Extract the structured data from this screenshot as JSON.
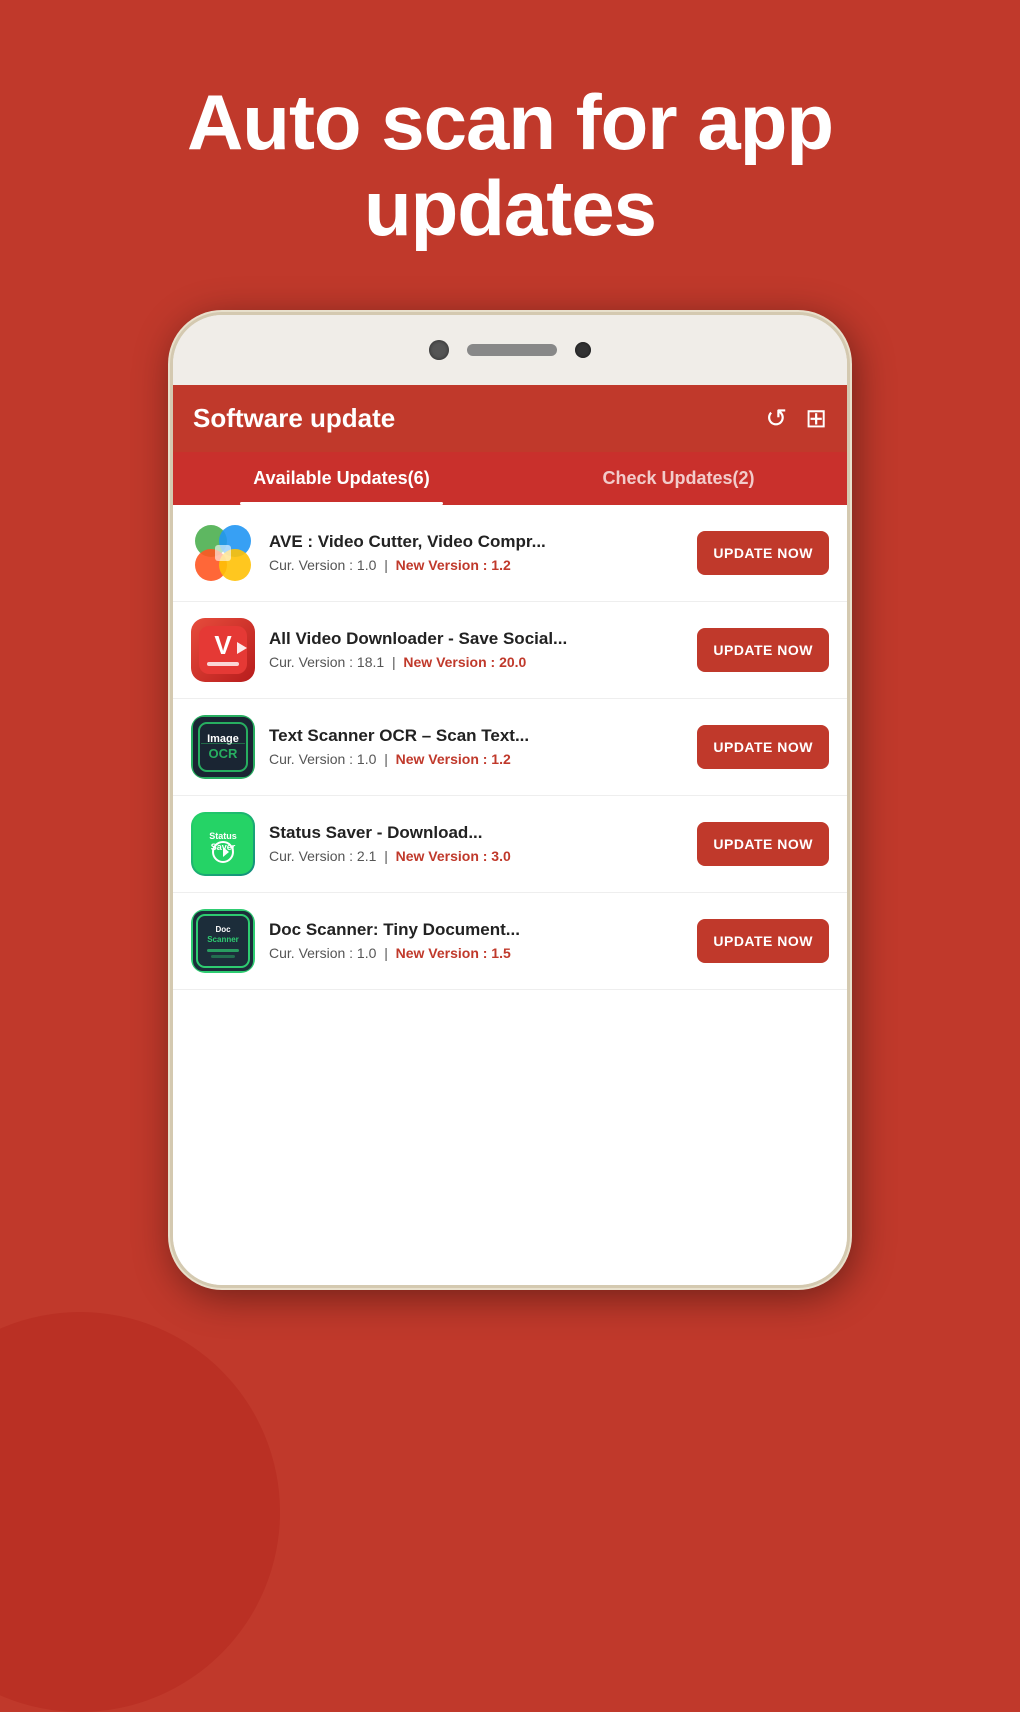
{
  "background_color": "#c0392b",
  "hero": {
    "title": "Auto scan for app updates"
  },
  "app_header": {
    "title": "Software update",
    "refresh_icon": "↺",
    "grid_icon": "⊞"
  },
  "tabs": [
    {
      "label": "Available Updates(6)",
      "active": true
    },
    {
      "label": "Check Updates(2)",
      "active": false
    }
  ],
  "apps": [
    {
      "name": "AVE : Video Cutter,  Video Compr...",
      "cur_version_label": "Cur. Version : 1.0",
      "separator": "|",
      "new_version_label": "New Version : 1.2",
      "update_button": "UPDATE NOW",
      "icon_type": "ave"
    },
    {
      "name": "All Video Downloader - Save Social...",
      "cur_version_label": "Cur. Version : 18.1",
      "separator": "|",
      "new_version_label": "New Version : 20.0",
      "update_button": "UPDATE NOW",
      "icon_type": "vd"
    },
    {
      "name": "Text Scanner OCR – Scan Text...",
      "cur_version_label": "Cur. Version : 1.0",
      "separator": "|",
      "new_version_label": "New Version : 1.2",
      "update_button": "UPDATE NOW",
      "icon_type": "ocr"
    },
    {
      "name": "Status Saver - Download...",
      "cur_version_label": "Cur. Version : 2.1",
      "separator": "|",
      "new_version_label": "New Version : 3.0",
      "update_button": "UPDATE NOW",
      "icon_type": "ss"
    },
    {
      "name": "Doc Scanner: Tiny Document...",
      "cur_version_label": "Cur. Version : 1.0",
      "separator": "|",
      "new_version_label": "New Version : 1.5",
      "update_button": "UPDATE NOW",
      "icon_type": "doc"
    }
  ]
}
